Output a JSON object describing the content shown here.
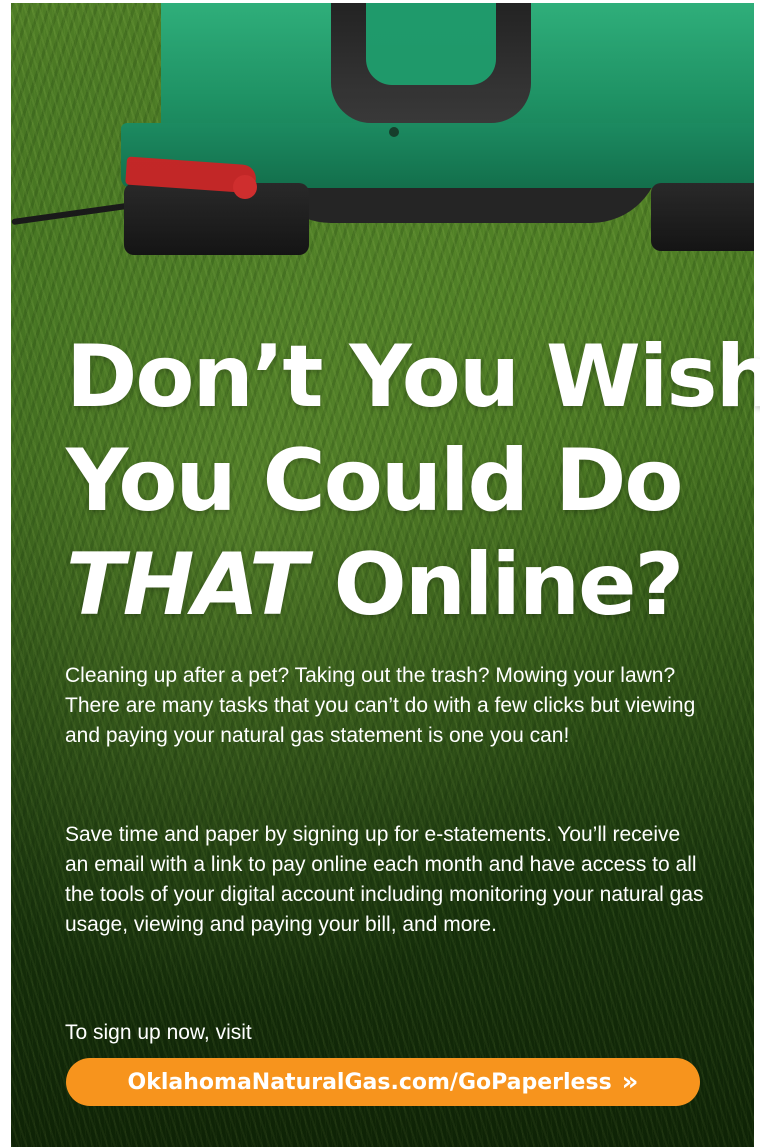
{
  "headline": {
    "line1": "Don’t You Wish",
    "line2": "You Could Do",
    "line3_emphasis": "THAT",
    "line3_rest": " Online?"
  },
  "body": {
    "paragraph1": "Cleaning up after a pet? Taking out the trash? Mowing your lawn? There are many tasks that you can’t do with a few clicks but viewing and paying your natural gas statement is one you can!",
    "paragraph2": "Save time and paper by signing up for e-statements. You’ll receive an email with a link to pay online each month and have access to all the tools of your digital account including monitoring your natural gas usage, viewing and paying your bill, and more.",
    "paragraph3": "To sign up now, visit"
  },
  "cta": {
    "label": "OklahomaNaturalGas.com/GoPaperless",
    "arrow_icon": "double-chevron-right-icon",
    "arrow_glyph": "»",
    "color": "#f7941d"
  },
  "colors": {
    "text": "#ffffff",
    "background": "#2d5616"
  }
}
